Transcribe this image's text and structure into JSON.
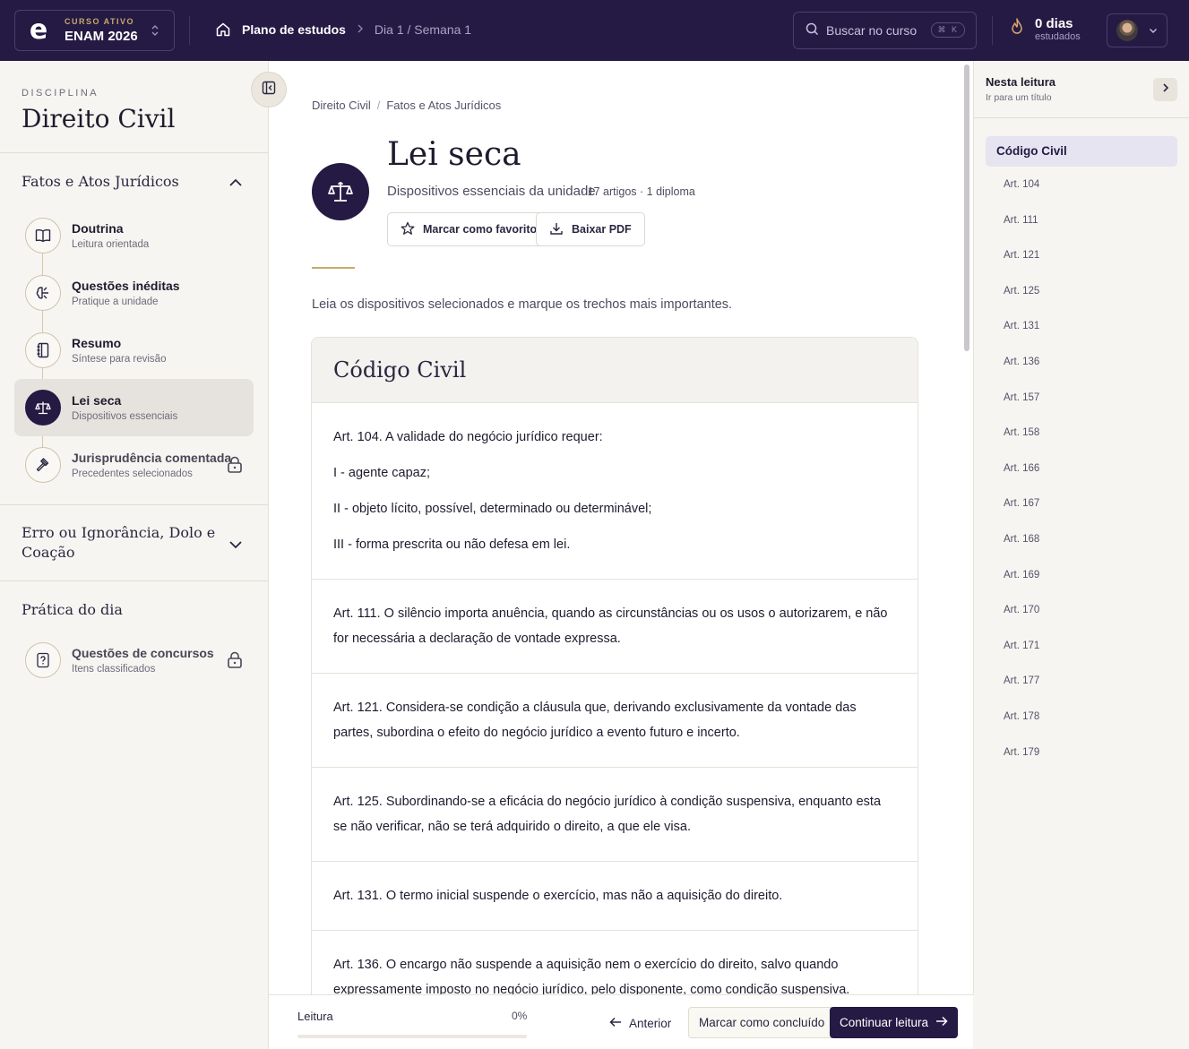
{
  "topbar": {
    "logo": "e",
    "course_kicker": "CURSO ATIVO",
    "course_name": "ENAM 2026",
    "breadcrumb_main": "Plano de estudos",
    "breadcrumb_sub": "Dia 1 / Semana 1",
    "search_placeholder": "Buscar no curso",
    "search_shortcut": "⌘ K",
    "streak_value": "0 dias",
    "streak_label": "estudados"
  },
  "sidebar": {
    "discipline_label": "DISCIPLINA",
    "discipline_title": "Direito Civil",
    "section1": "Fatos e Atos Jurídicos",
    "items": [
      {
        "title": "Doutrina",
        "subtitle": "Leitura orientada",
        "icon": "book-icon",
        "state": "default"
      },
      {
        "title": "Questões inéditas",
        "subtitle": "Pratique a unidade",
        "icon": "brain-icon",
        "state": "default"
      },
      {
        "title": "Resumo",
        "subtitle": "Síntese para revisão",
        "icon": "notebook-icon",
        "state": "default"
      },
      {
        "title": "Lei seca",
        "subtitle": "Dispositivos essenciais",
        "icon": "scales-icon",
        "state": "active"
      },
      {
        "title": "Jurisprudência comentada",
        "subtitle": "Precedentes selecionados",
        "icon": "gavel-icon",
        "state": "locked"
      }
    ],
    "section2": "Erro ou Ignorância, Dolo e Coação",
    "section3": "Prática do dia",
    "practice_item": {
      "title": "Questões de concursos",
      "subtitle": "Itens classificados",
      "icon": "question-doc-icon",
      "state": "locked"
    }
  },
  "main": {
    "breadcrumb": [
      "Direito Civil",
      "Fatos e Atos Jurídicos"
    ],
    "title": "Lei seca",
    "subtitle": "Dispositivos essenciais da unidade",
    "meta": "· 17 artigos · 1 diploma",
    "favorite_label": "Marcar como favorito",
    "download_label": "Baixar PDF",
    "intro": "Leia os dispositivos selecionados e marque os trechos mais importantes.",
    "card_title": "Código Civil",
    "articles": [
      [
        "Art. 104. A validade do negócio jurídico requer:",
        "I - agente capaz;",
        "II - objeto lícito, possível, determinado ou determinável;",
        "III - forma prescrita ou não defesa em lei."
      ],
      [
        "Art. 111. O silêncio importa anuência, quando as circunstâncias ou os usos o autorizarem, e não for necessária a declaração de vontade expressa."
      ],
      [
        "Art. 121. Considera-se condição a cláusula que, derivando exclusivamente da vontade das partes, subordina o efeito do negócio jurídico a evento futuro e incerto."
      ],
      [
        "Art. 125. Subordinando-se a eficácia do negócio jurídico à condição suspensiva, enquanto esta se não verificar, não se terá adquirido o direito, a que ele visa."
      ],
      [
        "Art. 131. O termo inicial suspende o exercício, mas não a aquisição do direito."
      ],
      [
        "Art. 136. O encargo não suspende a aquisição nem o exercício do direito, salvo quando expressamente imposto no negócio jurídico, pelo disponente, como condição suspensiva."
      ]
    ]
  },
  "bottombar": {
    "progress_label": "Leitura",
    "progress_pct": "0%",
    "progress_value": 0,
    "prev_label": "Anterior",
    "done_label": "Marcar como concluído",
    "next_label": "Continuar leitura"
  },
  "toc": {
    "title": "Nesta leitura",
    "subtitle": "Ir para um título",
    "active": "Código Civil",
    "items": [
      "Art. 104",
      "Art. 111",
      "Art. 121",
      "Art. 125",
      "Art. 131",
      "Art. 136",
      "Art. 157",
      "Art. 158",
      "Art. 166",
      "Art. 167",
      "Art. 168",
      "Art. 169",
      "Art. 170",
      "Art. 171",
      "Art. 177",
      "Art. 178",
      "Art. 179"
    ]
  },
  "colors": {
    "brand": "#241a44",
    "accent_gold": "#c9a86a",
    "background": "#f7f5f1"
  }
}
